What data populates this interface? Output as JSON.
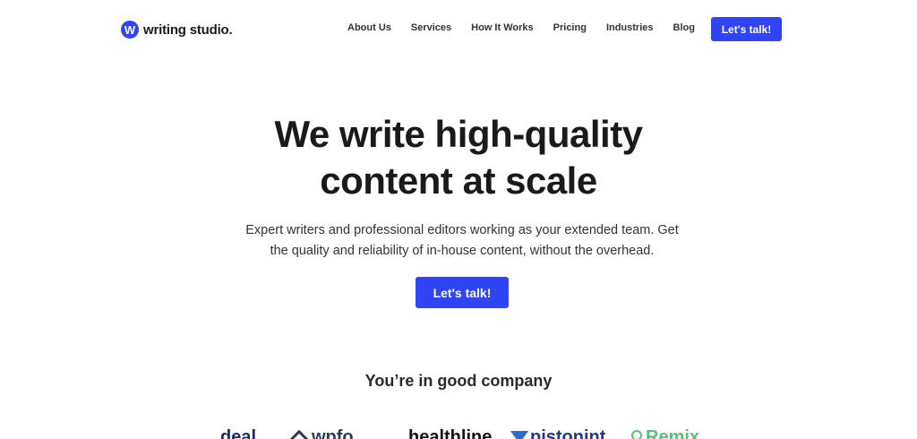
{
  "brand": {
    "logo_letter": "W",
    "name": "writing studio.",
    "accent": "#2f44f5"
  },
  "nav": {
    "items": [
      {
        "label": "About Us"
      },
      {
        "label": "Services"
      },
      {
        "label": "How It Works"
      },
      {
        "label": "Pricing"
      },
      {
        "label": "Industries"
      },
      {
        "label": "Blog"
      }
    ],
    "cta_label": "Let's talk!"
  },
  "hero": {
    "title_line1": "We write high-quality",
    "title_line2": "content at scale",
    "subtitle_line1": "Expert writers and professional editors working as your extended team. Get",
    "subtitle_line2": "the quality and reliability of in-house content, without the overhead.",
    "cta_label": "Let's talk!"
  },
  "social_proof": {
    "heading": "You’re in good company",
    "logos": [
      {
        "icon": "deal-logo",
        "text": "deal"
      },
      {
        "icon": "diamond-shape-icon",
        "text": "wpfo"
      },
      {
        "icon": "healthline-logo",
        "text": "healthline"
      },
      {
        "icon": "triangle-shape-icon",
        "text": "pistonint"
      },
      {
        "icon": "pin-shape-icon",
        "text": "Remix"
      }
    ]
  }
}
